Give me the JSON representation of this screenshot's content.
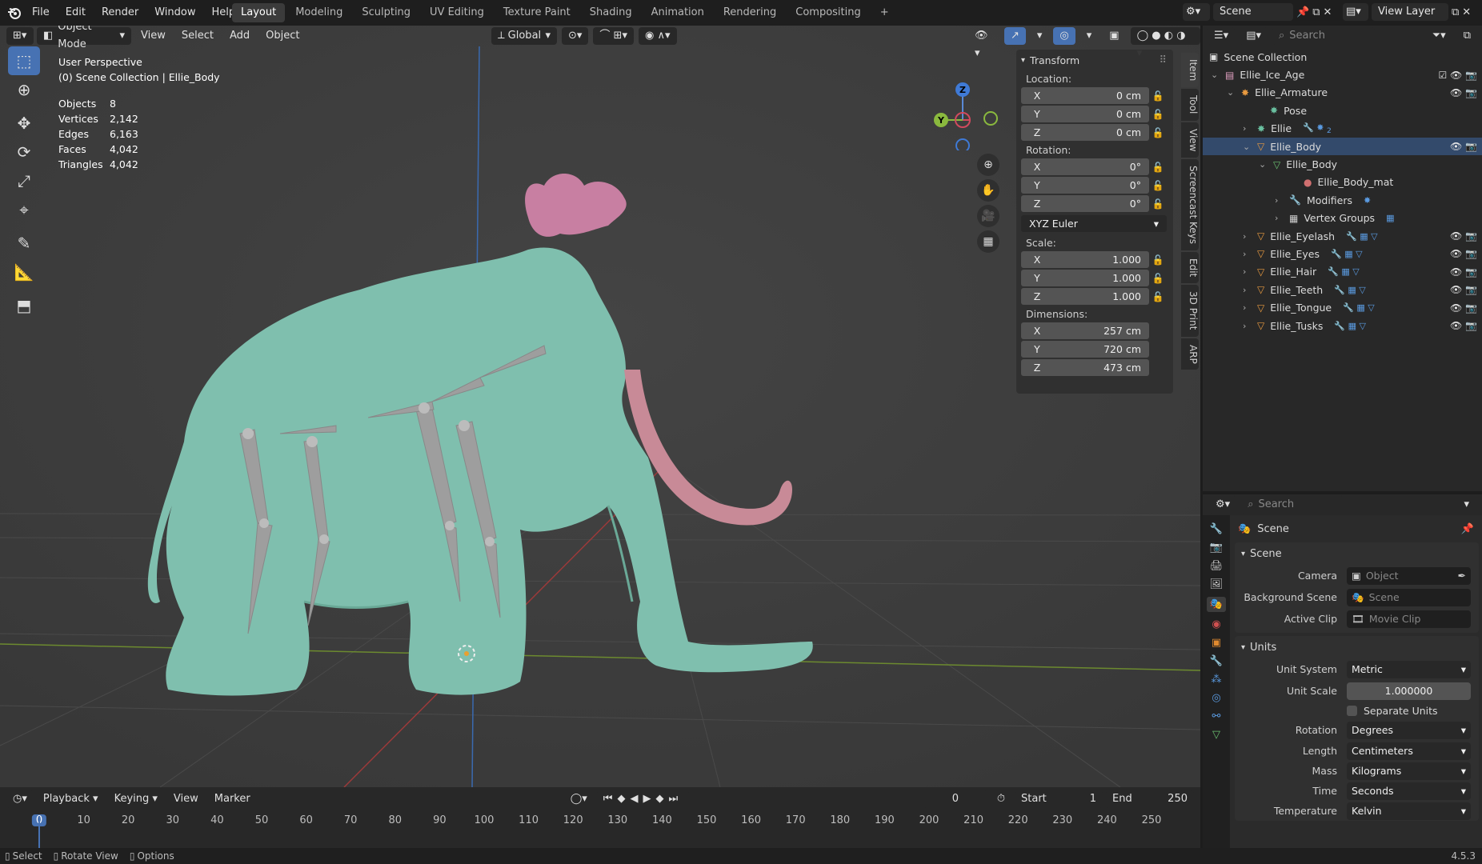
{
  "menu": {
    "items": [
      "File",
      "Edit",
      "Render",
      "Window",
      "Help"
    ]
  },
  "workspaces": [
    "Layout",
    "Modeling",
    "Sculpting",
    "UV Editing",
    "Texture Paint",
    "Shading",
    "Animation",
    "Rendering",
    "Compositing"
  ],
  "plus": "+",
  "scene_field": "Scene",
  "view_layer_field": "View Layer",
  "viewport": {
    "mode": "Object Mode",
    "menu": [
      "View",
      "Select",
      "Add",
      "Object"
    ],
    "orientation": "Global",
    "perspective": "User Perspective",
    "collection": "(0) Scene Collection | Ellie_Body",
    "stats": [
      [
        "Objects",
        "8"
      ],
      [
        "Vertices",
        "2,142"
      ],
      [
        "Edges",
        "6,163"
      ],
      [
        "Faces",
        "4,042"
      ],
      [
        "Triangles",
        "4,042"
      ]
    ]
  },
  "gizmo": {
    "z": "Z",
    "y": "Y"
  },
  "npanel": {
    "title": "Transform",
    "location_label": "Location:",
    "location": [
      [
        "X",
        "0 cm"
      ],
      [
        "Y",
        "0 cm"
      ],
      [
        "Z",
        "0 cm"
      ]
    ],
    "rotation_label": "Rotation:",
    "rotation": [
      [
        "X",
        "0°"
      ],
      [
        "Y",
        "0°"
      ],
      [
        "Z",
        "0°"
      ]
    ],
    "rotation_mode": "XYZ Euler",
    "scale_label": "Scale:",
    "scale": [
      [
        "X",
        "1.000"
      ],
      [
        "Y",
        "1.000"
      ],
      [
        "Z",
        "1.000"
      ]
    ],
    "dimensions_label": "Dimensions:",
    "dimensions": [
      [
        "X",
        "257 cm"
      ],
      [
        "Y",
        "720 cm"
      ],
      [
        "Z",
        "473 cm"
      ]
    ],
    "tabs": [
      "Item",
      "Tool",
      "View",
      "Screencast Keys",
      "Edit",
      "3D Print",
      "ARP"
    ]
  },
  "outliner": {
    "search_placeholder": "Search",
    "rows": [
      "Scene Collection",
      "Ellie_Ice_Age",
      "Ellie_Armature",
      "Pose",
      "Ellie",
      "Ellie_Body",
      "Ellie_Body",
      "Ellie_Body_mat",
      "Modifiers",
      "Vertex Groups",
      "Ellie_Eyelash",
      "Ellie_Eyes",
      "Ellie_Hair",
      "Ellie_Teeth",
      "Ellie_Tongue",
      "Ellie_Tusks"
    ],
    "ellie_count": "2"
  },
  "properties": {
    "search_placeholder": "Search",
    "context": "Scene",
    "scene_panel": "Scene",
    "camera_label": "Camera",
    "camera_placeholder": "Object",
    "bg_label": "Background Scene",
    "bg_placeholder": "Scene",
    "clip_label": "Active Clip",
    "clip_placeholder": "Movie Clip",
    "units_panel": "Units",
    "unit_system_label": "Unit System",
    "unit_system": "Metric",
    "unit_scale_label": "Unit Scale",
    "unit_scale": "1.000000",
    "separate_units": "Separate Units",
    "rotation_label": "Rotation",
    "rotation": "Degrees",
    "length_label": "Length",
    "length": "Centimeters",
    "mass_label": "Mass",
    "mass": "Kilograms",
    "time_label": "Time",
    "time": "Seconds",
    "temperature_label": "Temperature",
    "temperature": "Kelvin"
  },
  "timeline": {
    "menu": [
      "Playback",
      "Keying",
      "View",
      "Marker"
    ],
    "current_frame": "0",
    "start_label": "Start",
    "start": "1",
    "end_label": "End",
    "end": "250",
    "ticks": [
      "0",
      "10",
      "20",
      "30",
      "40",
      "50",
      "60",
      "70",
      "80",
      "90",
      "100",
      "110",
      "120",
      "130",
      "140",
      "150",
      "160",
      "170",
      "180",
      "190",
      "200",
      "210",
      "220",
      "230",
      "240",
      "250"
    ]
  },
  "status": {
    "select": "Select",
    "rotate": "Rotate View",
    "options": "Options",
    "version": "4.5.3"
  }
}
